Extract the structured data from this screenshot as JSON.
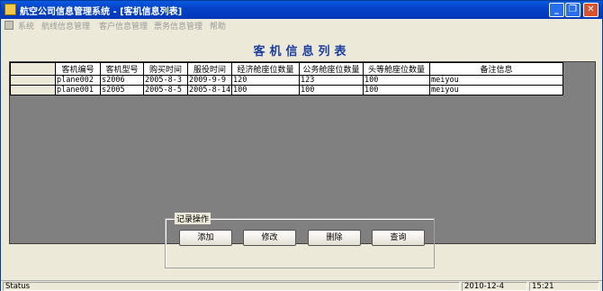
{
  "window": {
    "title": "航空公司信息管理系统 - [客机信息列表]",
    "min": "_",
    "restore": "❐",
    "close": "✕"
  },
  "menu": [
    "系统",
    "航线信息管理",
    "客户信息管理",
    "票务信息管理",
    "帮助"
  ],
  "page_title": "客机信息列表",
  "table": {
    "columns": [
      "客机编号",
      "客机型号",
      "购买时间",
      "服役时间",
      "经济舱座位数量",
      "公务舱座位数量",
      "头等舱座位数量",
      "备注信息"
    ],
    "rows": [
      [
        "plane002",
        "s2006",
        "2005-8-3",
        "2009-9-9",
        "120",
        "123",
        "100",
        "meiyou"
      ],
      [
        "plane001",
        "s2005",
        "2005-8-5",
        "2005-8-14",
        "100",
        "100",
        "100",
        "meiyou"
      ]
    ]
  },
  "group": {
    "label": "记录操作",
    "buttons": [
      "添加",
      "修改",
      "删除",
      "查询"
    ]
  },
  "status": {
    "text": "Status",
    "date": "2010-12-4",
    "time": "15:21"
  },
  "colors": {
    "title_bar": "#0542c8",
    "page_title": "#1c3fa0",
    "grid_background": "#808080"
  }
}
